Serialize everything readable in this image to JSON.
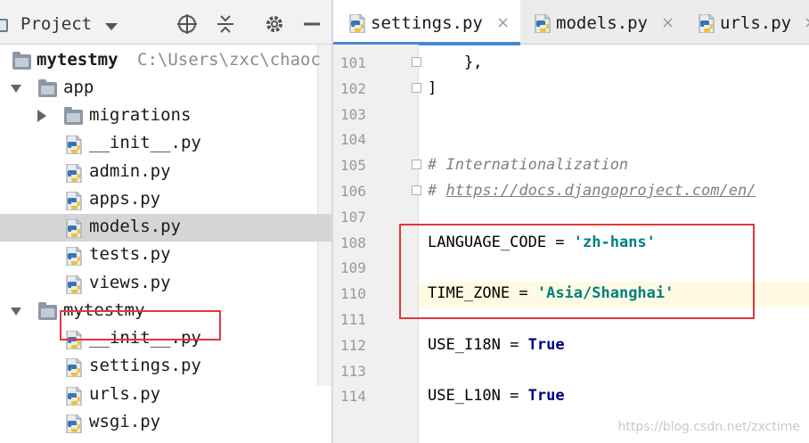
{
  "project_panel": {
    "title": "Project",
    "tree": [
      {
        "label": "mytestmy",
        "path": "C:\\Users\\zxc\\chaoc",
        "bold": true
      },
      {
        "label": "app"
      },
      {
        "label": "migrations"
      },
      {
        "label": "__init__.py"
      },
      {
        "label": "admin.py"
      },
      {
        "label": "apps.py"
      },
      {
        "label": "models.py",
        "selected": true
      },
      {
        "label": "tests.py"
      },
      {
        "label": "views.py"
      },
      {
        "label": "mytestmy"
      },
      {
        "label": "__init__.py"
      },
      {
        "label": "settings.py",
        "highlighted": true
      },
      {
        "label": "urls.py"
      },
      {
        "label": "wsgi.py"
      }
    ]
  },
  "editor": {
    "tabs": [
      {
        "label": "settings.py",
        "active": true,
        "close": "×"
      },
      {
        "label": "models.py",
        "close": "×"
      },
      {
        "label": "urls.py",
        "close": "×"
      }
    ],
    "lines": [
      {
        "num": "101",
        "code": "    },"
      },
      {
        "num": "102",
        "code": "]"
      },
      {
        "num": "103",
        "code": ""
      },
      {
        "num": "104",
        "code": ""
      },
      {
        "num": "105",
        "comment": "# Internationalization"
      },
      {
        "num": "106",
        "comment_prefix": "# ",
        "url": "https://docs.djangoproject.com/en/"
      },
      {
        "num": "107",
        "code": ""
      },
      {
        "num": "108",
        "name": "LANGUAGE_CODE",
        "op": " = ",
        "value": "'zh-hans'"
      },
      {
        "num": "109",
        "code": ""
      },
      {
        "num": "110",
        "name": "TIME_ZONE",
        "op": " = ",
        "value": "'Asia/Shanghai'",
        "current": true
      },
      {
        "num": "111",
        "code": ""
      },
      {
        "num": "112",
        "name": "USE_I18N",
        "op": " = ",
        "keyword": "True"
      },
      {
        "num": "113",
        "code": ""
      },
      {
        "num": "114",
        "name": "USE_L10N",
        "op": " = ",
        "keyword": "True"
      }
    ]
  },
  "watermark": "https://blog.csdn.net/zxctime",
  "colors": {
    "highlight_box": "#e0383b",
    "string": "#008080",
    "keyword": "#000080",
    "comment": "#808080",
    "tab_underline": "#4d88d8",
    "current_line": "#fffae3",
    "selected_row": "#d5d5d5"
  }
}
